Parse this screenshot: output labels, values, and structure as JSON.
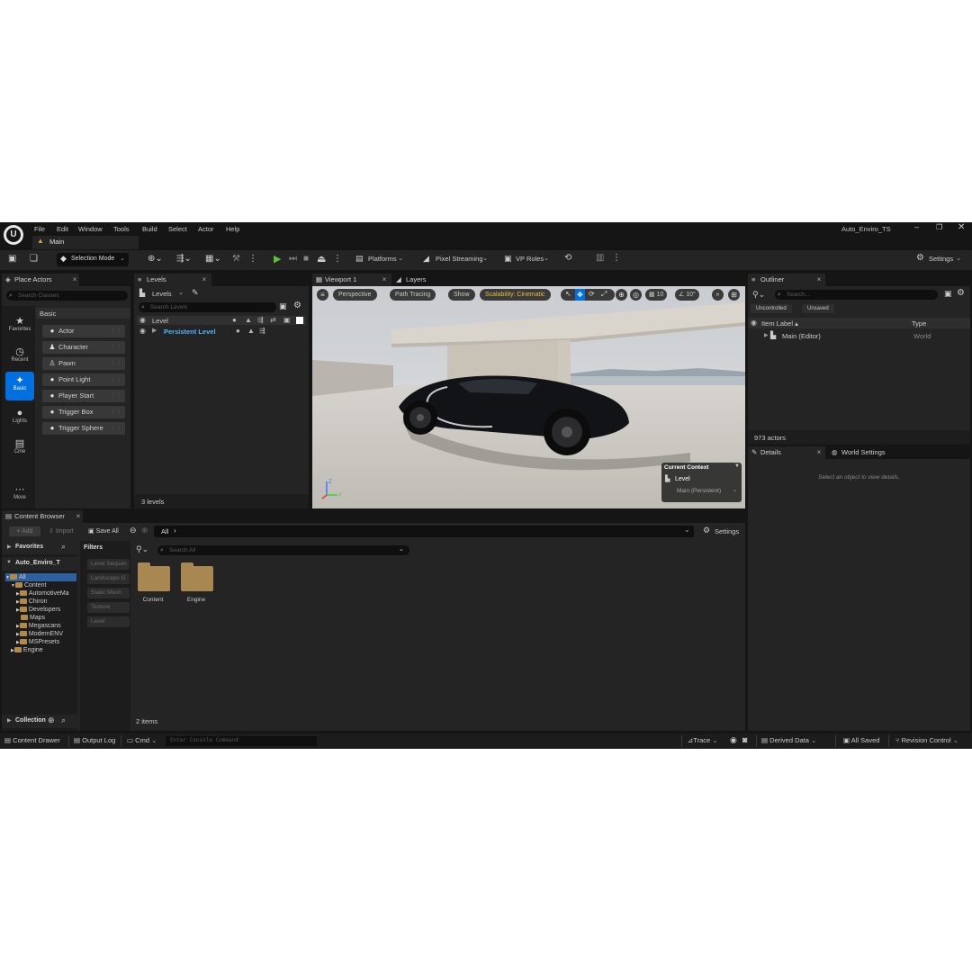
{
  "app": {
    "title": "Auto_Enviro_TS",
    "tab": "Main"
  },
  "menu": [
    "File",
    "Edit",
    "Window",
    "Tools",
    "Build",
    "Select",
    "Actor",
    "Help"
  ],
  "toolbar": {
    "selection_mode": "Selection Mode",
    "platforms": "Platforms",
    "pixel_streaming": "Pixel Streaming",
    "vp_roles": "VP Roles",
    "settings": "Settings"
  },
  "place_actors": {
    "tab": "Place Actors",
    "search_placeholder": "Search Classes",
    "section": "Basic",
    "categories": [
      {
        "label": "Favorites",
        "icon": "star-icon",
        "glyph": "★"
      },
      {
        "label": "Recent",
        "icon": "clock-icon",
        "glyph": "◷"
      },
      {
        "label": "Basic",
        "icon": "basic-shapes-icon",
        "glyph": "✦"
      },
      {
        "label": "Lights",
        "icon": "bulb-icon",
        "glyph": "●"
      },
      {
        "label": "Cine",
        "icon": "clapper-icon",
        "glyph": "▤"
      },
      {
        "label": "More",
        "icon": "more-icon",
        "glyph": "⋯"
      }
    ],
    "items": [
      {
        "label": "Actor",
        "glyph": "●"
      },
      {
        "label": "Character",
        "glyph": "♟"
      },
      {
        "label": "Pawn",
        "glyph": "♙"
      },
      {
        "label": "Point Light",
        "glyph": "●"
      },
      {
        "label": "Player Start",
        "glyph": "●"
      },
      {
        "label": "Trigger Box",
        "glyph": "●"
      },
      {
        "label": "Trigger Sphere",
        "glyph": "●"
      }
    ]
  },
  "levels": {
    "tab": "Levels",
    "dropdown": "Levels",
    "search_placeholder": "Search Levels",
    "header": "Level",
    "rows": [
      "Persistent Level"
    ],
    "count": "3 levels"
  },
  "viewport": {
    "tab": "Viewport 1",
    "tab2": "Layers",
    "perspective": "Perspective",
    "path_tracing": "Path Tracing",
    "show": "Show",
    "scalability": "Scalability: Cinematic",
    "grid_size": "10",
    "rotation_snap": "10°",
    "context_title": "Current Context",
    "context_level": "Level",
    "context_value": "Main (Persistent)"
  },
  "outliner": {
    "tab": "Outliner",
    "search_placeholder": "Search...",
    "chips": [
      "Uncontrolled",
      "Unsaved"
    ],
    "col_label": "Item Label",
    "col_type": "Type",
    "rows": [
      {
        "label": "Main (Editor)",
        "type": "World"
      }
    ],
    "count": "973 actors"
  },
  "details": {
    "tab": "Details",
    "tab2": "World Settings",
    "empty": "Select an object to view details."
  },
  "content_browser": {
    "tab": "Content Browser",
    "add": "Add",
    "import": "Import",
    "save_all": "Save All",
    "path": "All",
    "settings": "Settings",
    "favorites": "Favorites",
    "project": "Auto_Enviro_T",
    "filters_title": "Filters",
    "filters": [
      "Level Sequen",
      "Landscape G",
      "Static Mesh",
      "Texture",
      "Level"
    ],
    "search_placeholder": "Search All",
    "tree": {
      "all": "All",
      "content": "Content",
      "children": [
        "AutomotiveMa",
        "Chiron",
        "Developers",
        "Maps",
        "Megascans",
        "ModernENV",
        "MSPresets"
      ],
      "engine": "Engine"
    },
    "assets": [
      "Content",
      "Engine"
    ],
    "count": "2 items",
    "collection": "Collection"
  },
  "statusbar": {
    "content_drawer": "Content Drawer",
    "output_log": "Output Log",
    "cmd": "Cmd",
    "console_placeholder": "Enter Console Command",
    "trace": "Trace",
    "derived_data": "Derived Data",
    "all_saved": "All Saved",
    "revision_control": "Revision Control"
  },
  "colors": {
    "accent": "#0070e0",
    "scalability": "#e0c040",
    "persistent": "#4fb3ff"
  }
}
